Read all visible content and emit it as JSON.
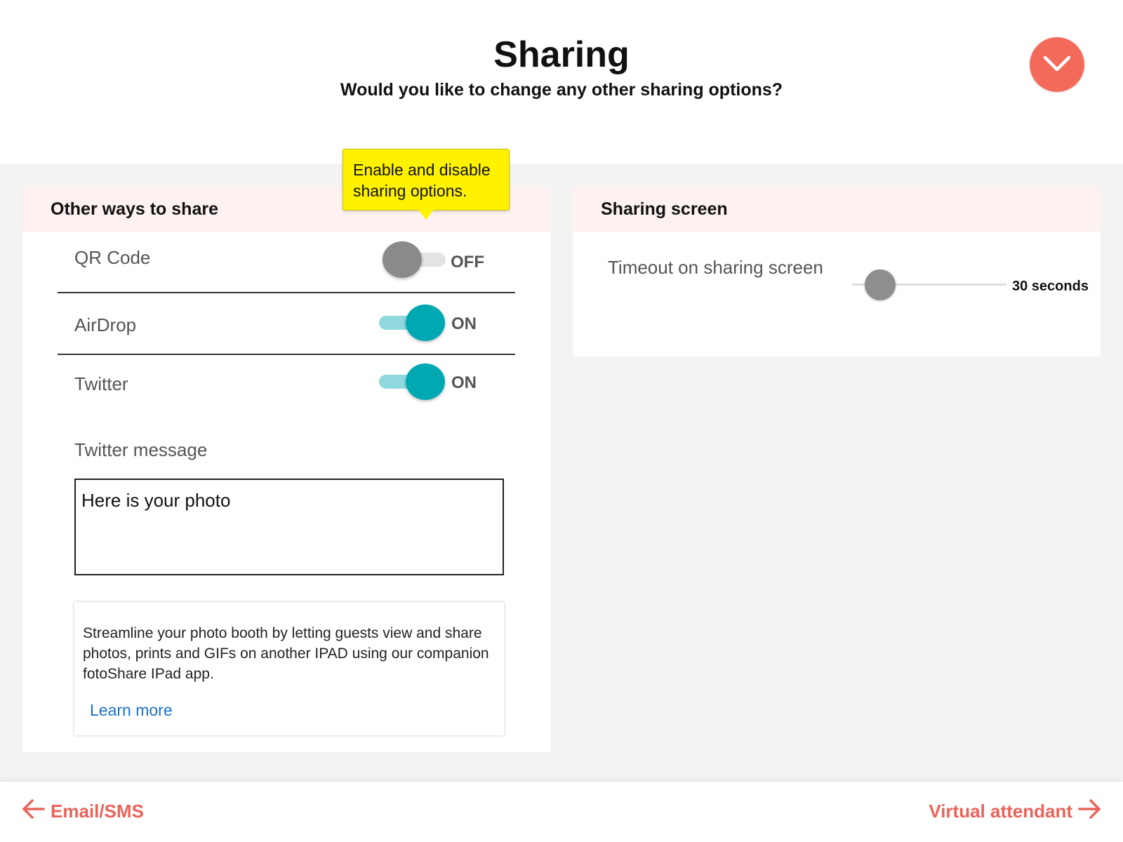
{
  "header": {
    "title": "Sharing",
    "subtitle": "Would you like to change any other sharing options?",
    "collapse_icon": "chevron-down-icon"
  },
  "colors": {
    "accent": "#f46a5a",
    "toggle_on": "#00a9b2",
    "toggle_off": "#8a8a8a",
    "tooltip_bg": "#fff200",
    "link": "#1a73c7",
    "nav": "#e9635a"
  },
  "tooltip": {
    "text": "Enable and disable sharing options."
  },
  "other_ways": {
    "heading": "Other ways to share",
    "options": [
      {
        "label": "QR Code",
        "enabled": false,
        "state_label": "OFF"
      },
      {
        "label": "AirDrop",
        "enabled": true,
        "state_label": "ON"
      },
      {
        "label": "Twitter",
        "enabled": true,
        "state_label": "ON"
      }
    ],
    "twitter_message_label": "Twitter message",
    "twitter_message_value": "Here is your photo",
    "info_text": "Streamline your photo booth by letting guests view and share photos, prints and GIFs on another IPAD using our companion fotoShare IPad app.",
    "learn_more": "Learn more"
  },
  "sharing_screen": {
    "heading": "Sharing screen",
    "timeout_label": "Timeout on sharing screen",
    "timeout_value": "30 seconds",
    "slider_fraction": 0.12
  },
  "footer": {
    "prev_label": "Email/SMS",
    "prev_icon": "arrow-left-icon",
    "next_label": "Virtual attendant",
    "next_icon": "arrow-right-icon"
  }
}
